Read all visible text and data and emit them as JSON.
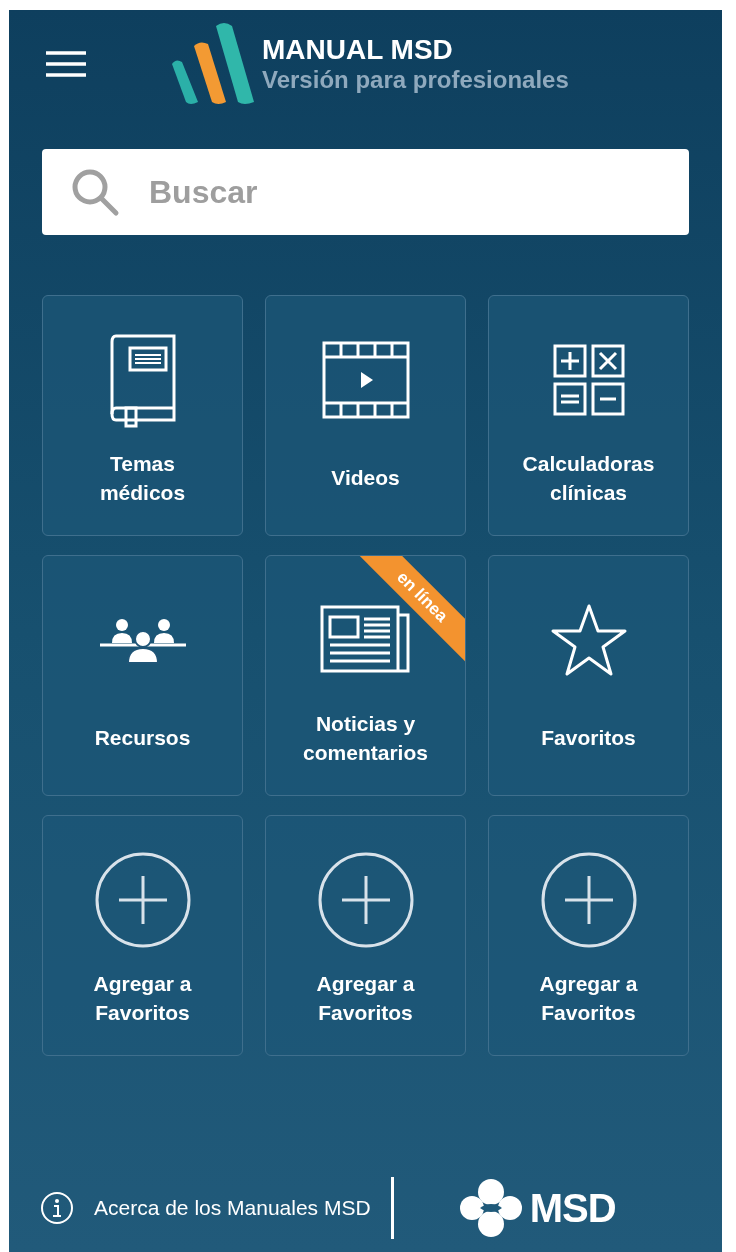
{
  "header": {
    "title": "MANUAL MSD",
    "subtitle": "Versión para profesionales"
  },
  "search": {
    "placeholder": "Buscar"
  },
  "tiles": [
    {
      "kind": "book",
      "label": "Temas médicos"
    },
    {
      "kind": "video",
      "label": "Videos"
    },
    {
      "kind": "calculator",
      "label": "Calculadoras clínicas"
    },
    {
      "kind": "people",
      "label": "Recursos"
    },
    {
      "kind": "newspaper",
      "label": "Noticias y comentarios",
      "badge": "en línea"
    },
    {
      "kind": "star",
      "label": "Favoritos"
    },
    {
      "kind": "add",
      "label": "Agregar a Favoritos"
    },
    {
      "kind": "add",
      "label": "Agregar a Favoritos"
    },
    {
      "kind": "add",
      "label": "Agregar a Favoritos"
    }
  ],
  "footer": {
    "about": "Acerca de los Manuales MSD",
    "brand": "MSD"
  }
}
